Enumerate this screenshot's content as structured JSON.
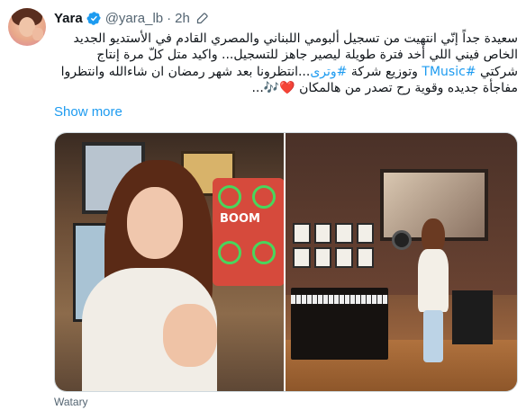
{
  "tweet": {
    "author_name": "Yara",
    "handle": "@yara_lb",
    "separator": "·",
    "time": "2h",
    "text_lines": [
      "سعيدة جداً إنّي انتهيت من تسجيل ألبومي اللبناني والمصري القادم في الأستديو الجديد",
      "الخاص فيني اللي أخد فترة طويلة ليصير جاهز للتسجيل... واكيد متل كلّ مرة إنتاج",
      "وتوزيع شركة #وترى...انتظرونا بعد شهر رمضان ان شاءالله وانتظروا",
      "مفاجأة جديده وقوية رح تصدر من هالمكان ❤️🎶..."
    ],
    "line3_prefix": "شركتي ",
    "line3_link": "#TMusic",
    "line3_mid": " وتوزيع شركة ",
    "line3_link2": "#وترى",
    "line3_suffix": "...انتظرونا بعد شهر رمضان ان شاءالله وانتظروا",
    "line4_text": "مفاجأة جديده وقوية رح تصدر من هالمكان",
    "line4_heart": "❤️",
    "line4_notes": "🎶",
    "line4_end": "...",
    "show_more": "Show more"
  },
  "media": {
    "boombox_text": "BOOM"
  },
  "watermark": "Watary",
  "colors": {
    "link": "#1d9bf0",
    "text": "#0f1419",
    "secondary": "#536471",
    "verified": "#1d9bf0"
  },
  "icons": {
    "verified": "verified-badge-icon",
    "edit": "edit-pencil-icon"
  }
}
